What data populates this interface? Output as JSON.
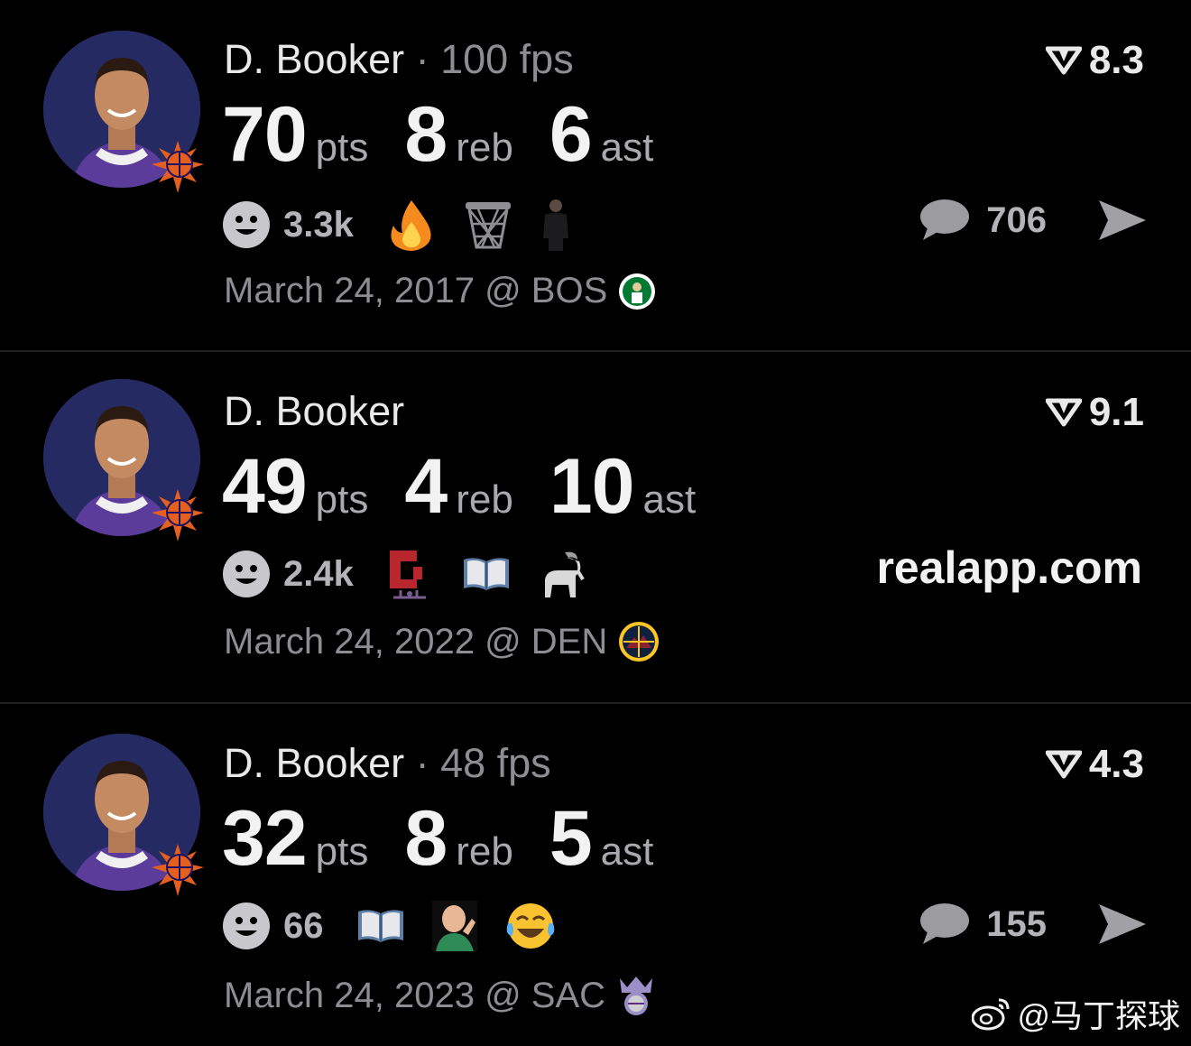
{
  "posts": [
    {
      "player": "D. Booker",
      "fps": "· 100 fps",
      "rating": "8.3",
      "pts": "70",
      "pts_label": "pts",
      "reb": "8",
      "reb_label": "reb",
      "ast": "6",
      "ast_label": "ast",
      "reactions": "3.3k",
      "comments": "706",
      "date": "March 24, 2017 @ BOS"
    },
    {
      "player": "D. Booker",
      "rating": "9.1",
      "pts": "49",
      "pts_label": "pts",
      "reb": "4",
      "reb_label": "reb",
      "ast": "10",
      "ast_label": "ast",
      "reactions": "2.4k",
      "site": "realapp.com",
      "date": "March 24, 2022 @ DEN"
    },
    {
      "player": "D. Booker",
      "fps": "· 48 fps",
      "rating": "4.3",
      "pts": "32",
      "pts_label": "pts",
      "reb": "8",
      "reb_label": "reb",
      "ast": "5",
      "ast_label": "ast",
      "reactions": "66",
      "comments": "155",
      "date": "March 24, 2023 @ SAC"
    }
  ],
  "watermark": "@马丁探球",
  "icons": {
    "rating": "rating-arrow-icon",
    "reaction": "smiley-icon",
    "comment": "comment-bubble-icon",
    "share": "share-send-icon"
  },
  "colors": {
    "background": "#000000",
    "primary_text": "#e9e9ea",
    "secondary_text": "#8d8d92",
    "avatar_bg": "#262a63"
  }
}
